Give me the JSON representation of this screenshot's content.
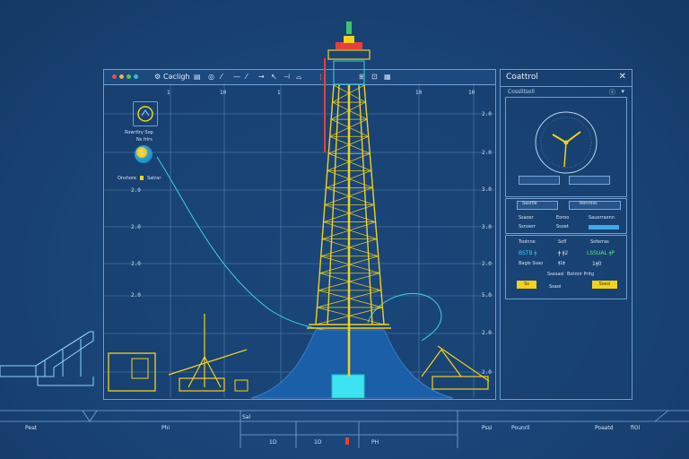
{
  "main_window": {
    "title": "Cəcligh",
    "scale_top": [
      "1",
      "10",
      "1",
      "10",
      "10"
    ],
    "y_ticks": [
      "2.0",
      "2.0",
      "3.0",
      "3.0",
      "2.0",
      "5.0",
      "2.0",
      "2.0"
    ],
    "y_ticks_left": [
      "2.0",
      "2.0",
      "2.0",
      "2.0"
    ],
    "legend": {
      "item1": "Rowrtlry Sop",
      "item2": "Ns  frlrs",
      "item3": "Onshore",
      "item4": "Satrar"
    },
    "accent": "#f2d21b"
  },
  "control_panel": {
    "title": "Coattrol",
    "subtitle": "Cosslitsoll",
    "row1": {
      "left": "Sasrile",
      "right": "Ronross"
    },
    "row2": {
      "left": "Ssaosr",
      "mid": "Eoroo",
      "right": "Sauerraenn"
    },
    "row3": {
      "left": "Ssnoerr",
      "mid": "Ssoet",
      "right": ""
    },
    "row4": {
      "left": "Tsolnne",
      "mid": "Sofl",
      "right": "Soferras"
    },
    "row5": {
      "left": "BSTB ǂ",
      "mid": "ǂ ǂ2",
      "right": "LSSUAL ǂP"
    },
    "row6": {
      "left": "Bagls Ssao",
      "mid": "ǂ1ǂ",
      "right": "1ǂ0"
    },
    "row7": {
      "left": "Ssesasl",
      "mid": "Botroir Pritg",
      "right": ""
    },
    "row8": {
      "left": "Sanr",
      "mid": "Ssaoi",
      "right": ""
    },
    "btn_left": "Ss",
    "btn_right": "Sossi"
  },
  "bottom_bar": {
    "labels": [
      "Peat",
      "Phi",
      "Sal",
      "Pssi",
      "Pounrll",
      "Poaatd",
      "fiOl"
    ],
    "sub": [
      "1D",
      "1D",
      "PH"
    ]
  }
}
